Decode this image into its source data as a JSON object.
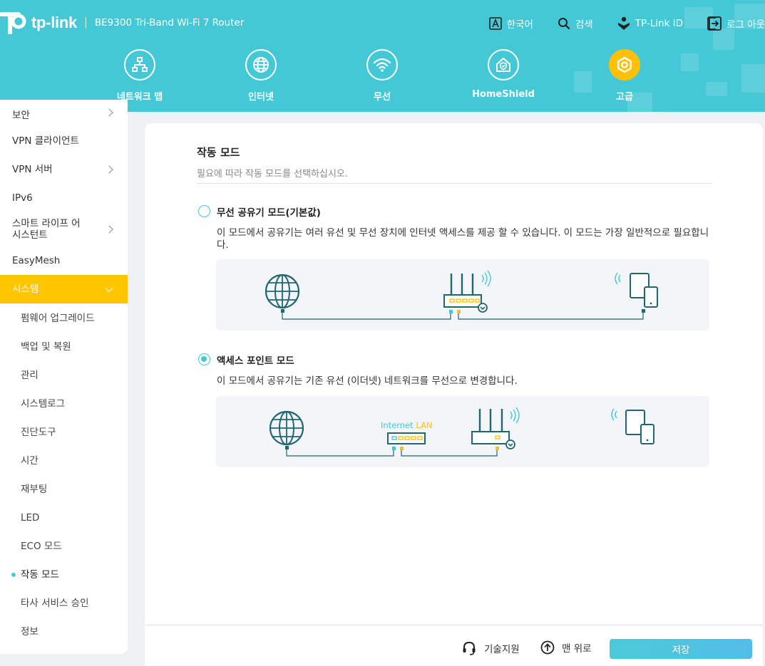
{
  "header": {
    "brand": "tp-link",
    "model": "BE9300 Tri-Band Wi-Fi 7 Router",
    "links": [
      {
        "label": "한국어",
        "icon": "language-icon"
      },
      {
        "label": "검색",
        "icon": "search-icon"
      },
      {
        "label": "TP-Link ID",
        "icon": "tplink-id-icon"
      },
      {
        "label": "로그 아웃",
        "icon": "logout-icon"
      }
    ],
    "nav": [
      {
        "label": "네트워크 맵",
        "icon": "network-map-icon"
      },
      {
        "label": "인터넷",
        "icon": "globe-icon"
      },
      {
        "label": "무선",
        "icon": "wifi-icon"
      },
      {
        "label": "HomeShield",
        "icon": "homeshield-icon"
      },
      {
        "label": "고급",
        "icon": "gear-icon",
        "active": true
      }
    ],
    "accent": "#45c8d6",
    "active_color": "#ffc107"
  },
  "sidebar": {
    "items": [
      {
        "label": "보안",
        "has_children": true
      },
      {
        "label": "VPN 클라이언트"
      },
      {
        "label": "VPN 서버",
        "has_children": true
      },
      {
        "label": "IPv6"
      },
      {
        "label": "스마트 라이프 어시스턴트",
        "has_children": true
      },
      {
        "label": "EasyMesh"
      },
      {
        "label": "시스템",
        "expanded": true
      }
    ],
    "sub_items": [
      {
        "label": "펌웨어 업그레이드"
      },
      {
        "label": "백업 및 복원"
      },
      {
        "label": "관리"
      },
      {
        "label": "시스템로그"
      },
      {
        "label": "진단도구"
      },
      {
        "label": "시간"
      },
      {
        "label": "재부팅"
      },
      {
        "label": "LED"
      },
      {
        "label": "ECO 모드"
      },
      {
        "label": "작동 모드",
        "current": true
      },
      {
        "label": "타사 서비스 승인"
      },
      {
        "label": "정보"
      }
    ]
  },
  "main": {
    "title": "작동 모드",
    "description": "필요에 따라 작동 모드를 선택하십시오.",
    "options": [
      {
        "title": "무선 공유기 모드(기본값)",
        "description": "이 모드에서 공유기는 여러 유선 및 무선 장치에 인터넷 액세스를 제공 할 수 있습니다. 이 모드는 가장 일반적으로 필요합니다.",
        "selected": false
      },
      {
        "title": "액세스 포인트 모드",
        "description": "이 모드에서 공유기는 기존 유선 (이더넷) 네트워크를 무선으로 변경합니다.",
        "selected": true,
        "diagram_labels": {
          "internet": "Internet",
          "lan": "LAN"
        }
      }
    ]
  },
  "footer": {
    "support": "기술지원",
    "top": "맨 위로",
    "save": "저장"
  }
}
